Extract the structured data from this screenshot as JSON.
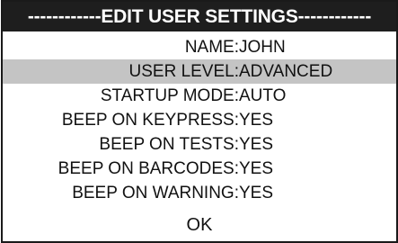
{
  "header": {
    "title": "------------EDIT USER SETTINGS------------"
  },
  "settings": [
    {
      "label": "NAME:",
      "value": "JOHN",
      "selected": false
    },
    {
      "label": "USER LEVEL:",
      "value": "ADVANCED",
      "selected": true
    },
    {
      "label": "STARTUP MODE:",
      "value": "AUTO",
      "selected": false
    },
    {
      "label": "BEEP ON KEYPRESS:",
      "value": "YES",
      "selected": false
    },
    {
      "label": "BEEP ON TESTS:",
      "value": "YES",
      "selected": false
    },
    {
      "label": "BEEP ON BARCODES:",
      "value": "YES",
      "selected": false
    },
    {
      "label": "BEEP ON WARNING:",
      "value": "YES",
      "selected": false
    }
  ],
  "ok_label": "OK",
  "colors": {
    "header_bg": "#1e1e1e",
    "header_text": "#ffffff",
    "selection_bg": "#c4c4c4"
  }
}
